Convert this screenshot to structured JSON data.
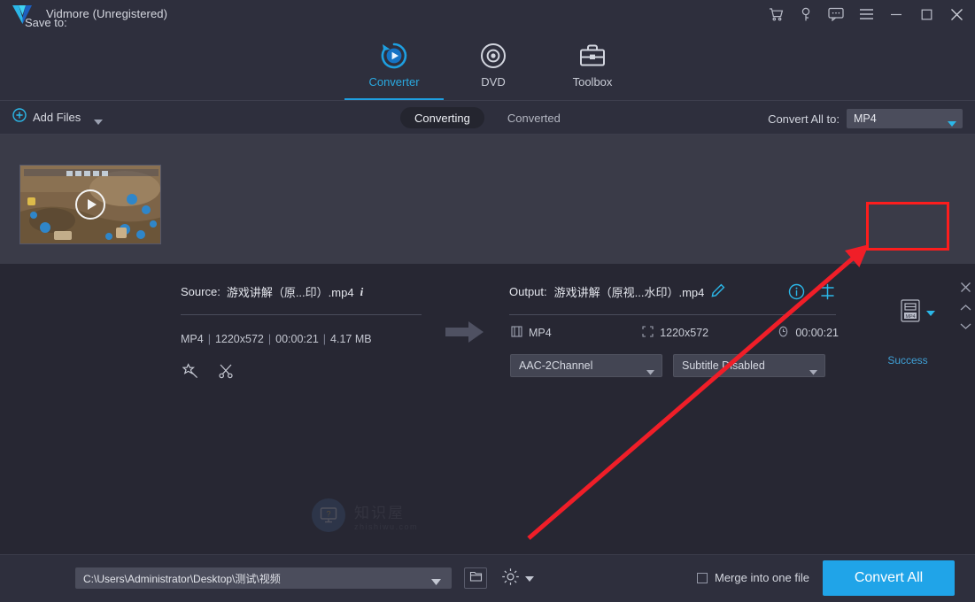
{
  "window": {
    "title": "Vidmore (Unregistered)",
    "logo_icon": "vidmore-checkmark-logo",
    "controls": [
      {
        "name": "cart-icon",
        "label": "⛉"
      },
      {
        "name": "key-icon",
        "label": "⚷"
      },
      {
        "name": "feedback-icon",
        "label": "…"
      },
      {
        "name": "menu-icon",
        "label": "≡"
      },
      {
        "name": "minimize-icon",
        "label": "—"
      },
      {
        "name": "maximize-icon",
        "label": "□"
      },
      {
        "name": "close-icon",
        "label": "✕"
      }
    ]
  },
  "tabs": [
    {
      "label": "Converter",
      "icon": "converter-icon",
      "active": true
    },
    {
      "label": "DVD",
      "icon": "dvd-icon",
      "active": false
    },
    {
      "label": "Toolbox",
      "icon": "toolbox-icon",
      "active": false
    }
  ],
  "toolbar": {
    "add_files_label": "Add Files",
    "add_files_icon": "plus-circle-icon",
    "segments": [
      {
        "label": "Converting",
        "active": true
      },
      {
        "label": "Converted",
        "active": false
      }
    ],
    "convert_all_to_label": "Convert All to:",
    "convert_all_to_value": "MP4"
  },
  "file": {
    "thumbnail_alt": "game-video-thumbnail",
    "play_icon": "play-button-icon",
    "source": {
      "prefix": "Source:",
      "filename": "游戏讲解（原...印）.mp4",
      "info_icon": "info-italic-icon",
      "format": "MP4",
      "resolution": "1220x572",
      "duration": "00:00:21",
      "filesize": "4.17 MB",
      "tools": [
        {
          "name": "edit-magic-wand-icon"
        },
        {
          "name": "trim-scissors-icon"
        }
      ]
    },
    "arrow_icon": "right-arrow-icon",
    "output": {
      "prefix": "Output:",
      "filename": "游戏讲解（原视...水印）.mp4",
      "rename_icon": "pencil-edit-icon",
      "info_icon": "info-circle-icon",
      "settings_icon": "merge-split-icon",
      "format": "MP4",
      "format_icon": "film-icon",
      "resolution": "1220x572",
      "resolution_icon": "resize-icon",
      "duration": "00:00:21",
      "duration_icon": "clock-icon",
      "audio_track": "AAC-2Channel",
      "subtitle_track": "Subtitle Disabled"
    },
    "format_badge_icon": "mp4-format-icon",
    "status": "Success",
    "row_controls": [
      {
        "name": "remove-file-icon",
        "label": "✕"
      },
      {
        "name": "move-up-icon",
        "label": "ⱏ"
      },
      {
        "name": "move-down-icon",
        "label": "ⱛ"
      }
    ]
  },
  "watermark": {
    "cn_text": "知识屋",
    "en_text": "zhishiwu.com",
    "icon": "monitor-question-icon"
  },
  "bottom": {
    "save_to_label": "Save to:",
    "save_path": "C:\\Users\\Administrator\\Desktop\\测试\\视频",
    "folder_icon": "open-folder-icon",
    "gear_icon": "settings-gear-icon",
    "merge_label": "Merge into one file",
    "merge_checked": false,
    "convert_all_label": "Convert All"
  },
  "annotation": {
    "highlight_color": "#fc1d1d",
    "arrow_from": "597,608",
    "arrow_to": "978,278"
  },
  "colors": {
    "accent": "#20a4e8",
    "titlebar_bg": "#2e2f3d",
    "content_bg": "#272733",
    "card_bg": "#3a3b48",
    "status_text": "#3fa0d6"
  }
}
